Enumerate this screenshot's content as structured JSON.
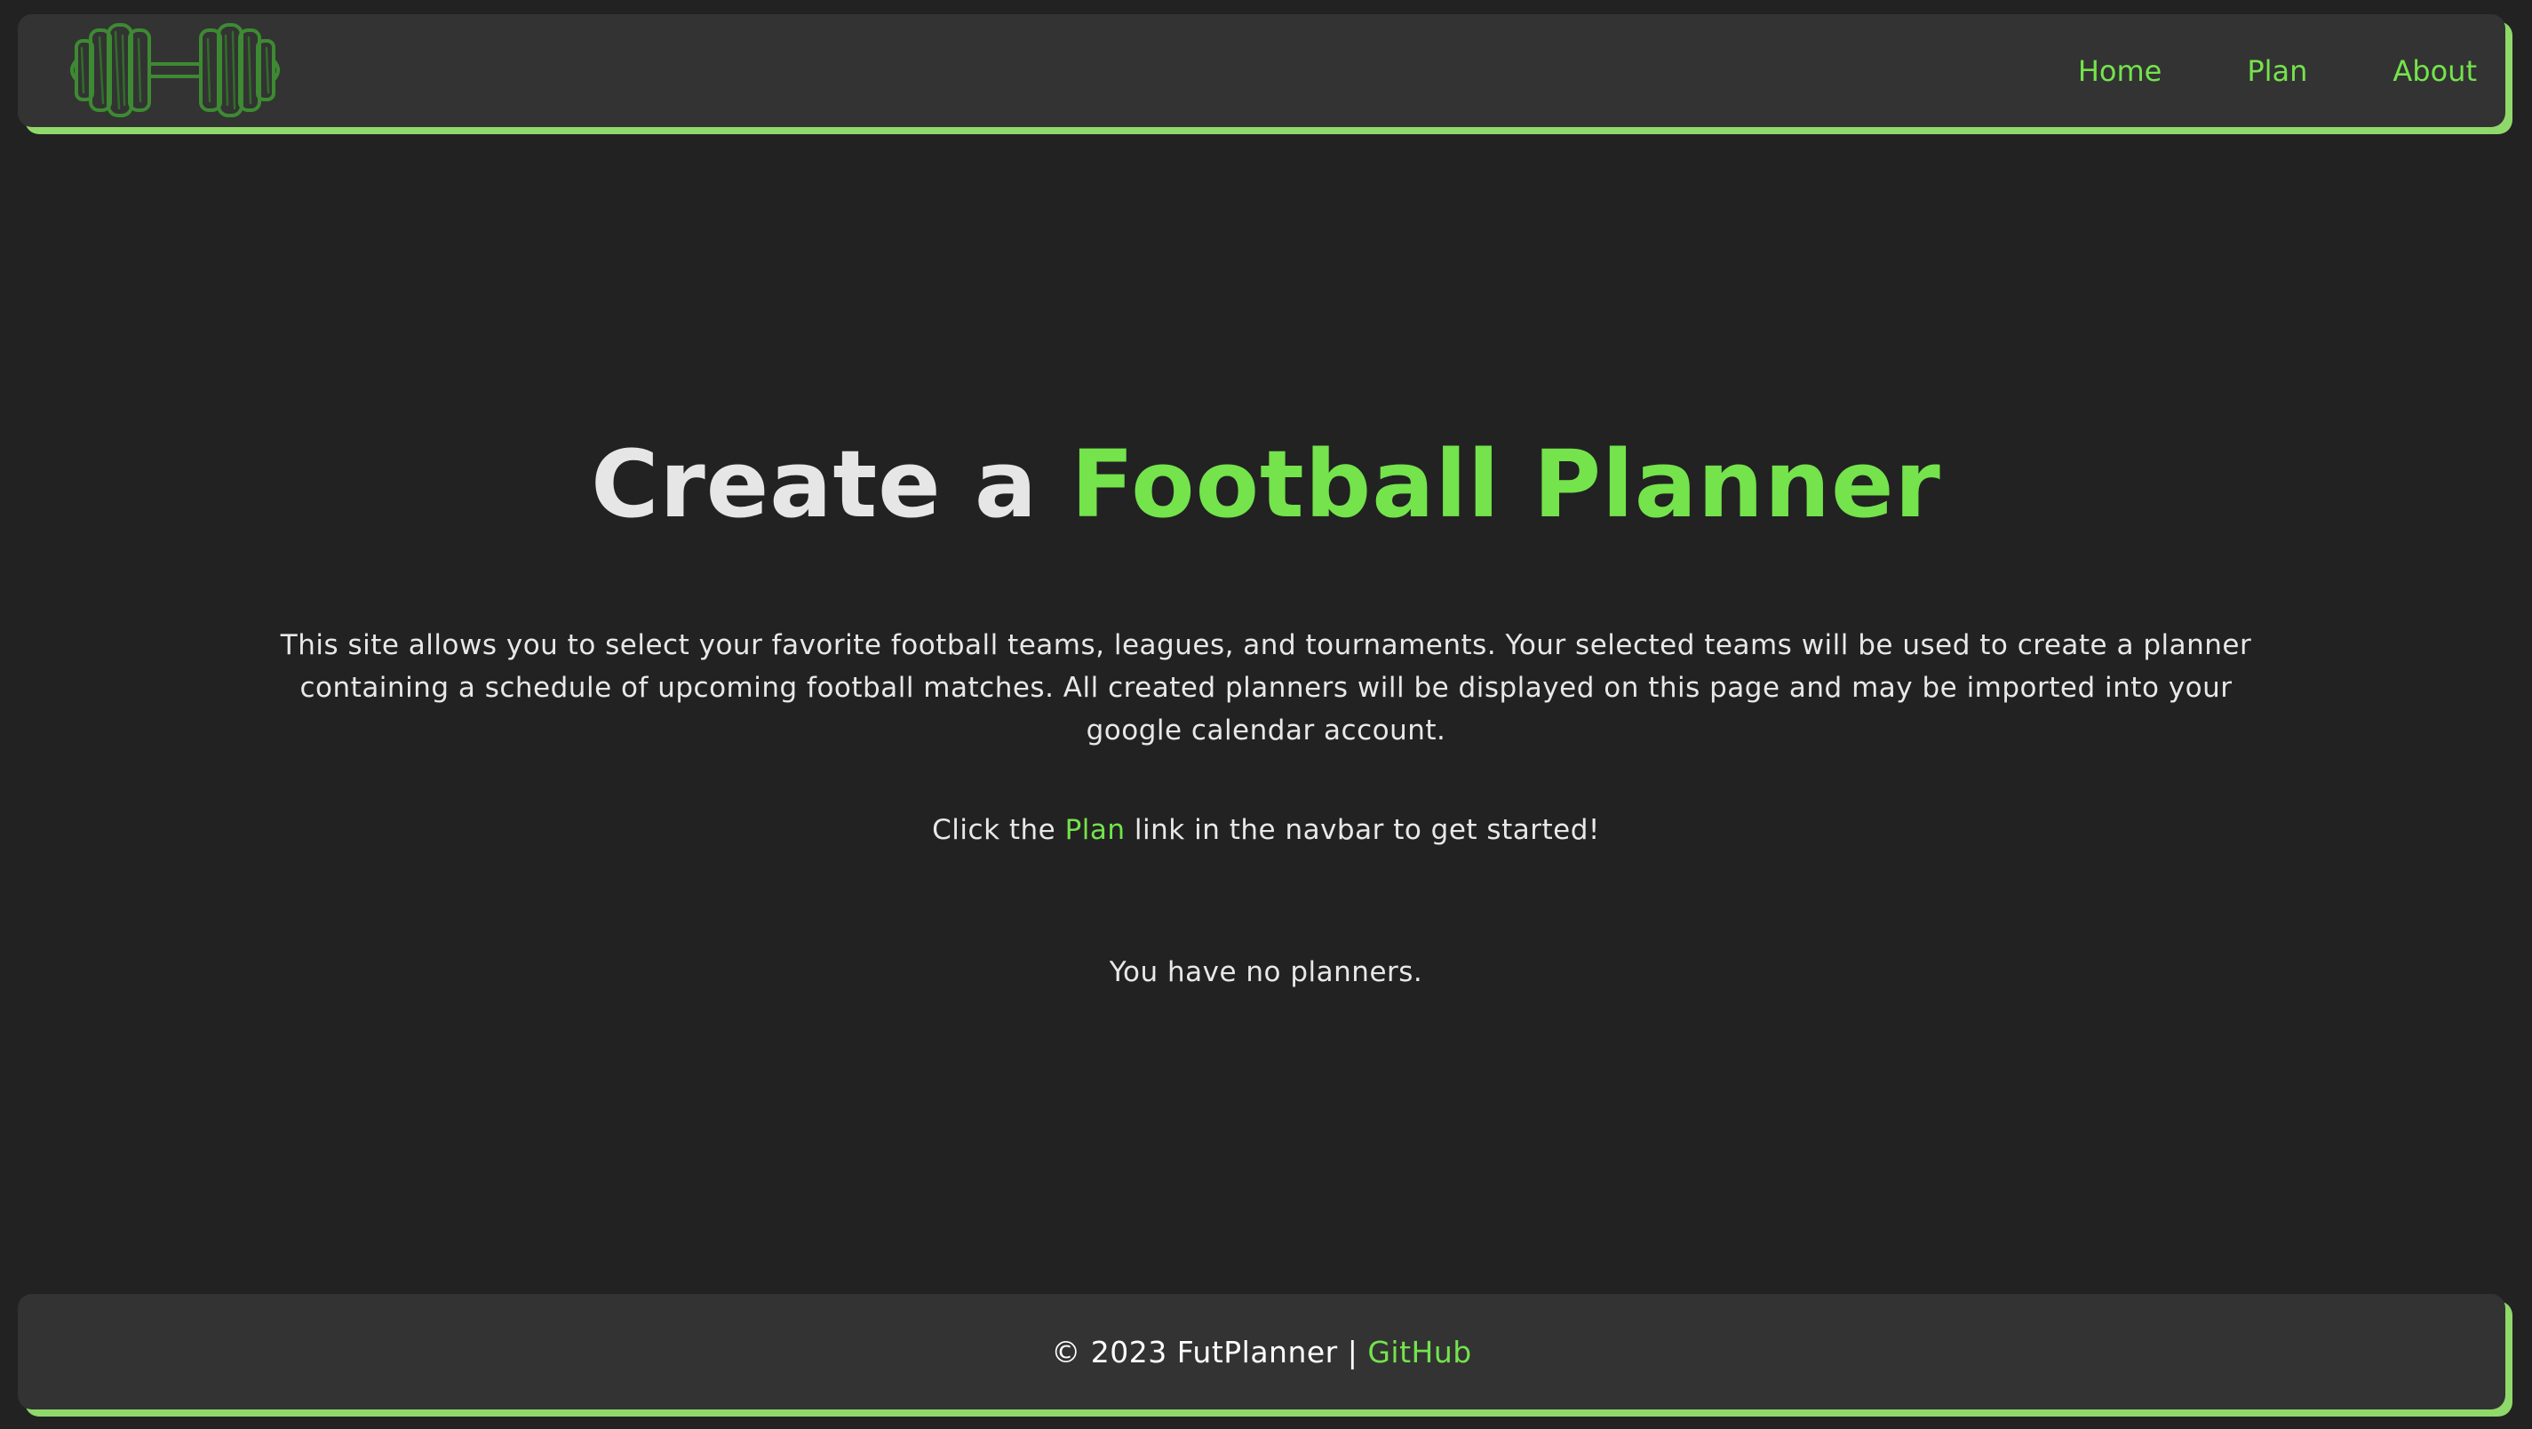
{
  "colors": {
    "background": "#222222",
    "bar": "#333333",
    "accent": "#74e34c",
    "bar_shadow": "#8fd96a",
    "text": "#e8e8e8"
  },
  "navbar": {
    "logo_icon": "dumbbell-icon",
    "links": [
      {
        "label": "Home"
      },
      {
        "label": "Plan"
      },
      {
        "label": "About"
      }
    ]
  },
  "hero": {
    "title_prefix": "Create a ",
    "title_accent": "Football Planner",
    "description": "This site allows you to select your favorite football teams, leagues, and tournaments. Your selected teams will be used to create a planner containing a schedule of upcoming football matches. All created planners will be displayed on this page and may be imported into your google calendar account.",
    "cta_before": "Click the ",
    "cta_link": "Plan",
    "cta_after": " link in the navbar to get started!",
    "empty_message": "You have no planners."
  },
  "footer": {
    "copyright": "© 2023 FutPlanner | ",
    "github_label": "GitHub"
  }
}
